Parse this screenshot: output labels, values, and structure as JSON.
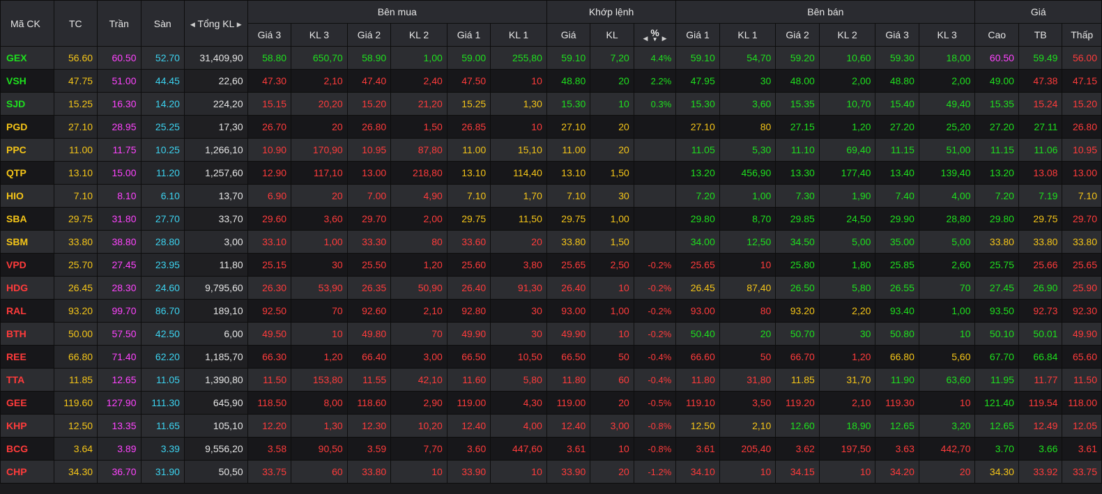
{
  "colors": {
    "up": "#1ee01e",
    "down": "#ff3b3b",
    "ref": "#f5c518",
    "ceil": "#ff44ff",
    "floor": "#3cd3f0",
    "neutral": "#e6e6e6"
  },
  "header": {
    "symbol": "Mã CK",
    "tc": "TC",
    "tran": "Trần",
    "san": "Sàn",
    "total": "Tổng KL",
    "bid_group": "Bên mua",
    "match_group": "Khớp lệnh",
    "ask_group": "Bên bán",
    "price_group": "Giá",
    "gia3": "Giá 3",
    "kl3": "KL 3",
    "gia2": "Giá 2",
    "kl2": "KL 2",
    "gia1": "Giá 1",
    "kl1": "KL 1",
    "gia": "Giá",
    "kl": "KL",
    "pct": "%",
    "ask_gia1": "Giá 1",
    "ask_kl1": "KL 1",
    "ask_gia2": "Giá 2",
    "ask_kl2": "KL 2",
    "ask_gia3": "Giá 3",
    "ask_kl3": "KL 3",
    "cao": "Cao",
    "tb": "TB",
    "thap": "Thấp"
  },
  "rows": [
    {
      "sym": "GEX",
      "tc": "56.60",
      "tran": "60.50",
      "san": "52.70",
      "total": "31,409,90",
      "b3p": "58.80",
      "b3v": "650,70",
      "b2p": "58.90",
      "b2v": "1,00",
      "b1p": "59.00",
      "b1v": "255,80",
      "mp": "59.10",
      "mv": "7,20",
      "pct": "4.4%",
      "a1p": "59.10",
      "a1v": "54,70",
      "a2p": "59.20",
      "a2v": "10,60",
      "a3p": "59.30",
      "a3v": "18,00",
      "hi": "60.50",
      "avg": "59.49",
      "lo": "56.00"
    },
    {
      "sym": "VSH",
      "tc": "47.75",
      "tran": "51.00",
      "san": "44.45",
      "total": "22,60",
      "b3p": "47.30",
      "b3v": "2,10",
      "b2p": "47.40",
      "b2v": "2,40",
      "b1p": "47.50",
      "b1v": "10",
      "mp": "48.80",
      "mv": "20",
      "pct": "2.2%",
      "a1p": "47.95",
      "a1v": "30",
      "a2p": "48.00",
      "a2v": "2,00",
      "a3p": "48.80",
      "a3v": "2,00",
      "hi": "49.00",
      "avg": "47.38",
      "lo": "47.15"
    },
    {
      "sym": "SJD",
      "tc": "15.25",
      "tran": "16.30",
      "san": "14.20",
      "total": "224,20",
      "b3p": "15.15",
      "b3v": "20,20",
      "b2p": "15.20",
      "b2v": "21,20",
      "b1p": "15.25",
      "b1v": "1,30",
      "mp": "15.30",
      "mv": "10",
      "pct": "0.3%",
      "a1p": "15.30",
      "a1v": "3,60",
      "a2p": "15.35",
      "a2v": "10,70",
      "a3p": "15.40",
      "a3v": "49,40",
      "hi": "15.35",
      "avg": "15.24",
      "lo": "15.20"
    },
    {
      "sym": "PGD",
      "tc": "27.10",
      "tran": "28.95",
      "san": "25.25",
      "total": "17,30",
      "b3p": "26.70",
      "b3v": "20",
      "b2p": "26.80",
      "b2v": "1,50",
      "b1p": "26.85",
      "b1v": "10",
      "mp": "27.10",
      "mv": "20",
      "pct": "",
      "a1p": "27.10",
      "a1v": "80",
      "a2p": "27.15",
      "a2v": "1,20",
      "a3p": "27.20",
      "a3v": "25,20",
      "hi": "27.20",
      "avg": "27.11",
      "lo": "26.80"
    },
    {
      "sym": "PPC",
      "tc": "11.00",
      "tran": "11.75",
      "san": "10.25",
      "total": "1,266,10",
      "b3p": "10.90",
      "b3v": "170,90",
      "b2p": "10.95",
      "b2v": "87,80",
      "b1p": "11.00",
      "b1v": "15,10",
      "mp": "11.00",
      "mv": "20",
      "pct": "",
      "a1p": "11.05",
      "a1v": "5,30",
      "a2p": "11.10",
      "a2v": "69,40",
      "a3p": "11.15",
      "a3v": "51,00",
      "hi": "11.15",
      "avg": "11.06",
      "lo": "10.95"
    },
    {
      "sym": "QTP",
      "tc": "13.10",
      "tran": "15.00",
      "san": "11.20",
      "total": "1,257,60",
      "b3p": "12.90",
      "b3v": "117,10",
      "b2p": "13.00",
      "b2v": "218,80",
      "b1p": "13.10",
      "b1v": "114,40",
      "mp": "13.10",
      "mv": "1,50",
      "pct": "",
      "a1p": "13.20",
      "a1v": "456,90",
      "a2p": "13.30",
      "a2v": "177,40",
      "a3p": "13.40",
      "a3v": "139,40",
      "hi": "13.20",
      "avg": "13.08",
      "lo": "13.00"
    },
    {
      "sym": "HIO",
      "tc": "7.10",
      "tran": "8.10",
      "san": "6.10",
      "total": "13,70",
      "b3p": "6.90",
      "b3v": "20",
      "b2p": "7.00",
      "b2v": "4,90",
      "b1p": "7.10",
      "b1v": "1,70",
      "mp": "7.10",
      "mv": "30",
      "pct": "",
      "a1p": "7.20",
      "a1v": "1,00",
      "a2p": "7.30",
      "a2v": "1,90",
      "a3p": "7.40",
      "a3v": "4,00",
      "hi": "7.20",
      "avg": "7.19",
      "lo": "7.10"
    },
    {
      "sym": "SBA",
      "tc": "29.75",
      "tran": "31.80",
      "san": "27.70",
      "total": "33,70",
      "b3p": "29.60",
      "b3v": "3,60",
      "b2p": "29.70",
      "b2v": "2,00",
      "b1p": "29.75",
      "b1v": "11,50",
      "mp": "29.75",
      "mv": "1,00",
      "pct": "",
      "a1p": "29.80",
      "a1v": "8,70",
      "a2p": "29.85",
      "a2v": "24,50",
      "a3p": "29.90",
      "a3v": "28,80",
      "hi": "29.80",
      "avg": "29.75",
      "lo": "29.70"
    },
    {
      "sym": "SBM",
      "tc": "33.80",
      "tran": "38.80",
      "san": "28.80",
      "total": "3,00",
      "b3p": "33.10",
      "b3v": "1,00",
      "b2p": "33.30",
      "b2v": "80",
      "b1p": "33.60",
      "b1v": "20",
      "mp": "33.80",
      "mv": "1,50",
      "pct": "",
      "a1p": "34.00",
      "a1v": "12,50",
      "a2p": "34.50",
      "a2v": "5,00",
      "a3p": "35.00",
      "a3v": "5,00",
      "hi": "33.80",
      "avg": "33.80",
      "lo": "33.80"
    },
    {
      "sym": "VPD",
      "tc": "25.70",
      "tran": "27.45",
      "san": "23.95",
      "total": "11,80",
      "b3p": "25.15",
      "b3v": "30",
      "b2p": "25.50",
      "b2v": "1,20",
      "b1p": "25.60",
      "b1v": "3,80",
      "mp": "25.65",
      "mv": "2,50",
      "pct": "-0.2%",
      "a1p": "25.65",
      "a1v": "10",
      "a2p": "25.80",
      "a2v": "1,80",
      "a3p": "25.85",
      "a3v": "2,60",
      "hi": "25.75",
      "avg": "25.66",
      "lo": "25.65"
    },
    {
      "sym": "HDG",
      "tc": "26.45",
      "tran": "28.30",
      "san": "24.60",
      "total": "9,795,60",
      "b3p": "26.30",
      "b3v": "53,90",
      "b2p": "26.35",
      "b2v": "50,90",
      "b1p": "26.40",
      "b1v": "91,30",
      "mp": "26.40",
      "mv": "10",
      "pct": "-0.2%",
      "a1p": "26.45",
      "a1v": "87,40",
      "a2p": "26.50",
      "a2v": "5,80",
      "a3p": "26.55",
      "a3v": "70",
      "hi": "27.45",
      "avg": "26.90",
      "lo": "25.90"
    },
    {
      "sym": "RAL",
      "tc": "93.20",
      "tran": "99.70",
      "san": "86.70",
      "total": "189,10",
      "b3p": "92.50",
      "b3v": "70",
      "b2p": "92.60",
      "b2v": "2,10",
      "b1p": "92.80",
      "b1v": "30",
      "mp": "93.00",
      "mv": "1,00",
      "pct": "-0.2%",
      "a1p": "93.00",
      "a1v": "80",
      "a2p": "93.20",
      "a2v": "2,20",
      "a3p": "93.40",
      "a3v": "1,00",
      "hi": "93.50",
      "avg": "92.73",
      "lo": "92.30"
    },
    {
      "sym": "BTH",
      "tc": "50.00",
      "tran": "57.50",
      "san": "42.50",
      "total": "6,00",
      "b3p": "49.50",
      "b3v": "10",
      "b2p": "49.80",
      "b2v": "70",
      "b1p": "49.90",
      "b1v": "30",
      "mp": "49.90",
      "mv": "10",
      "pct": "-0.2%",
      "a1p": "50.40",
      "a1v": "20",
      "a2p": "50.70",
      "a2v": "30",
      "a3p": "50.80",
      "a3v": "10",
      "hi": "50.10",
      "avg": "50.01",
      "lo": "49.90"
    },
    {
      "sym": "REE",
      "tc": "66.80",
      "tran": "71.40",
      "san": "62.20",
      "total": "1,185,70",
      "b3p": "66.30",
      "b3v": "1,20",
      "b2p": "66.40",
      "b2v": "3,00",
      "b1p": "66.50",
      "b1v": "10,50",
      "mp": "66.50",
      "mv": "50",
      "pct": "-0.4%",
      "a1p": "66.60",
      "a1v": "50",
      "a2p": "66.70",
      "a2v": "1,20",
      "a3p": "66.80",
      "a3v": "5,60",
      "hi": "67.70",
      "avg": "66.84",
      "lo": "65.60"
    },
    {
      "sym": "TTA",
      "tc": "11.85",
      "tran": "12.65",
      "san": "11.05",
      "total": "1,390,80",
      "b3p": "11.50",
      "b3v": "153,80",
      "b2p": "11.55",
      "b2v": "42,10",
      "b1p": "11.60",
      "b1v": "5,80",
      "mp": "11.80",
      "mv": "60",
      "pct": "-0.4%",
      "a1p": "11.80",
      "a1v": "31,80",
      "a2p": "11.85",
      "a2v": "31,70",
      "a3p": "11.90",
      "a3v": "63,60",
      "hi": "11.95",
      "avg": "11.77",
      "lo": "11.50"
    },
    {
      "sym": "GEE",
      "tc": "119.60",
      "tran": "127.90",
      "san": "111.30",
      "total": "645,90",
      "b3p": "118.50",
      "b3v": "8,00",
      "b2p": "118.60",
      "b2v": "2,90",
      "b1p": "119.00",
      "b1v": "4,30",
      "mp": "119.00",
      "mv": "20",
      "pct": "-0.5%",
      "a1p": "119.10",
      "a1v": "3,50",
      "a2p": "119.20",
      "a2v": "2,10",
      "a3p": "119.30",
      "a3v": "10",
      "hi": "121.40",
      "avg": "119.54",
      "lo": "118.00"
    },
    {
      "sym": "KHP",
      "tc": "12.50",
      "tran": "13.35",
      "san": "11.65",
      "total": "105,10",
      "b3p": "12.20",
      "b3v": "1,30",
      "b2p": "12.30",
      "b2v": "10,20",
      "b1p": "12.40",
      "b1v": "4,00",
      "mp": "12.40",
      "mv": "3,00",
      "pct": "-0.8%",
      "a1p": "12.50",
      "a1v": "2,10",
      "a2p": "12.60",
      "a2v": "18,90",
      "a3p": "12.65",
      "a3v": "3,20",
      "hi": "12.65",
      "avg": "12.49",
      "lo": "12.05"
    },
    {
      "sym": "BCG",
      "tc": "3.64",
      "tran": "3.89",
      "san": "3.39",
      "total": "9,556,20",
      "b3p": "3.58",
      "b3v": "90,50",
      "b2p": "3.59",
      "b2v": "7,70",
      "b1p": "3.60",
      "b1v": "447,60",
      "mp": "3.61",
      "mv": "10",
      "pct": "-0.8%",
      "a1p": "3.61",
      "a1v": "205,40",
      "a2p": "3.62",
      "a2v": "197,50",
      "a3p": "3.63",
      "a3v": "442,70",
      "hi": "3.70",
      "avg": "3.66",
      "lo": "3.61"
    },
    {
      "sym": "CHP",
      "tc": "34.30",
      "tran": "36.70",
      "san": "31.90",
      "total": "50,50",
      "b3p": "33.75",
      "b3v": "60",
      "b2p": "33.80",
      "b2v": "10",
      "b1p": "33.90",
      "b1v": "10",
      "mp": "33.90",
      "mv": "20",
      "pct": "-1.2%",
      "a1p": "34.10",
      "a1v": "10",
      "a2p": "34.15",
      "a2v": "10",
      "a3p": "34.20",
      "a3v": "20",
      "hi": "34.30",
      "avg": "33.92",
      "lo": "33.75"
    }
  ]
}
